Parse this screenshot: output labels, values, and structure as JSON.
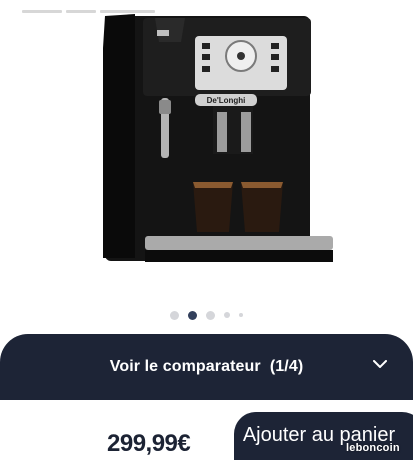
{
  "product": {
    "image_icon": "coffee-machine-image",
    "brand_logo": "De'Longhi"
  },
  "carousel": {
    "count": 5,
    "active_index": 1
  },
  "comparator": {
    "label": "Voir le comparateur",
    "counter": "(1/4)",
    "icon": "chevron-down-icon"
  },
  "purchase": {
    "price": "299,99€",
    "cart_label": "Ajouter au panier"
  },
  "watermark": "leboncoin",
  "colors": {
    "dark_navy": "#1d2436",
    "dot_active": "#33405c",
    "dot_inactive": "#d5d6da"
  }
}
